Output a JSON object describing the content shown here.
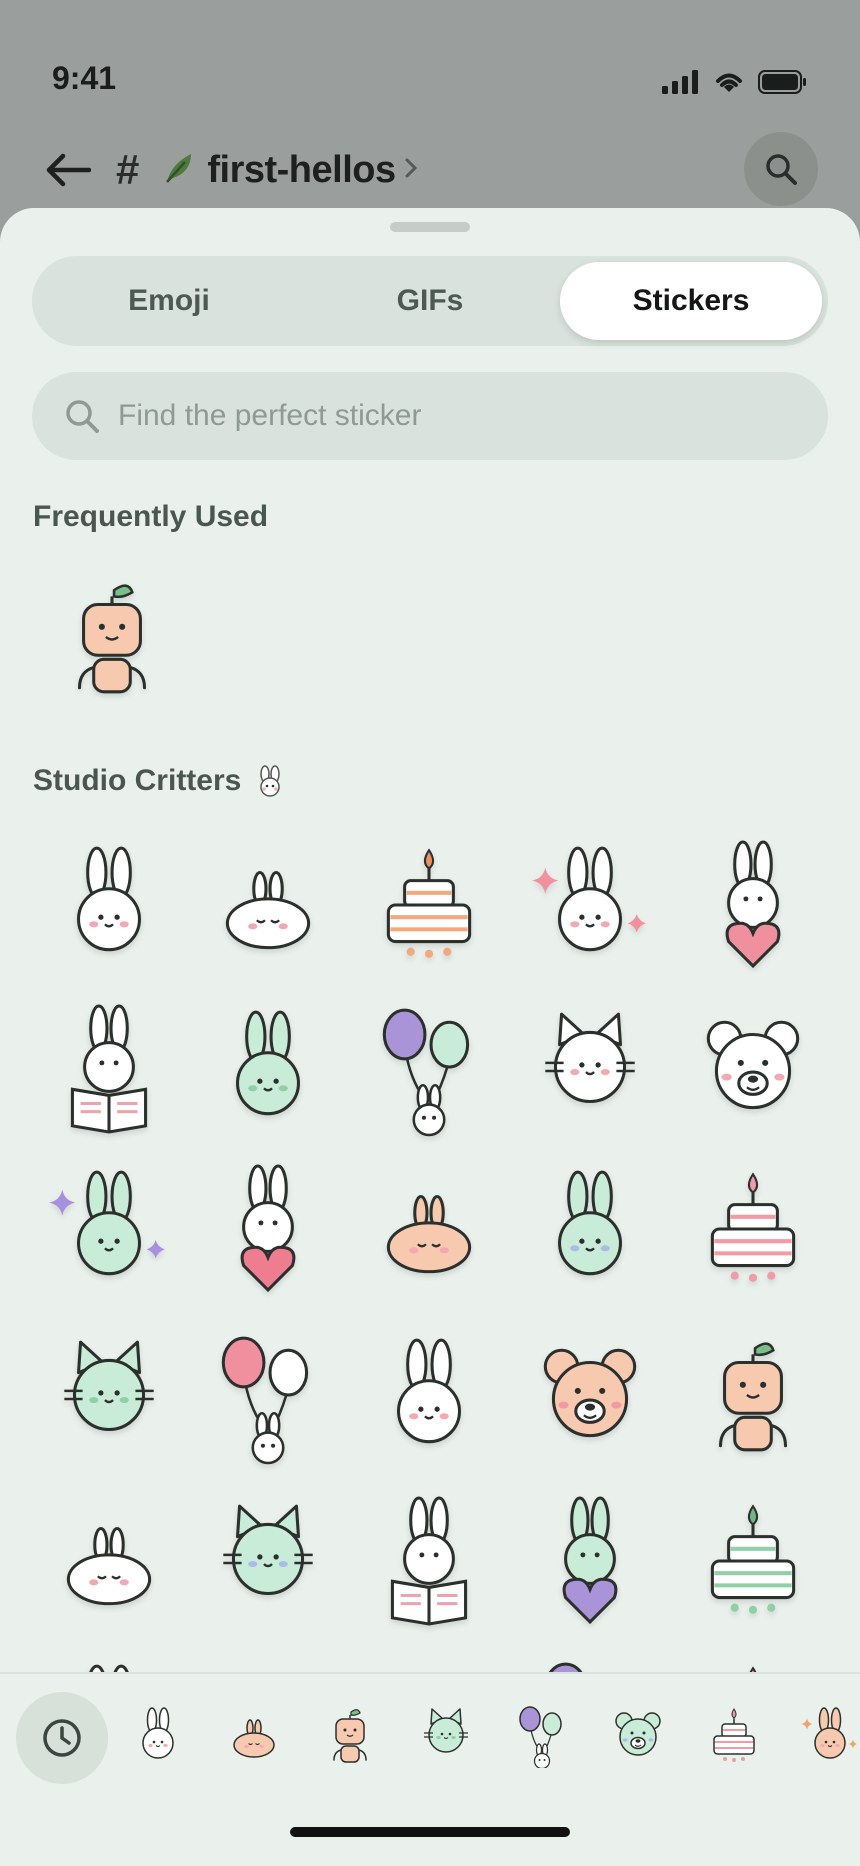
{
  "status_bar": {
    "time": "9:41"
  },
  "header": {
    "channel_name": "first-hellos",
    "hash": "#"
  },
  "tabs": [
    {
      "label": "Emoji",
      "active": false
    },
    {
      "label": "GIFs",
      "active": false
    },
    {
      "label": "Stickers",
      "active": true
    }
  ],
  "search": {
    "placeholder": "Find the perfect sticker"
  },
  "sections": {
    "frequently_used": {
      "title": "Frequently Used",
      "stickers": [
        "robot"
      ]
    },
    "studio_critters": {
      "title": "Studio Critters",
      "stickers": [
        "bunny-white",
        "bunny-sleepy",
        "cake-peach",
        "bunny-sparkle-pink",
        "bunny-heart-pink",
        "bunny-book-pink",
        "bunny-mint",
        "balloons-purple-bunny",
        "cat-white",
        "bear-white",
        "bunny-sparkle-purple",
        "bunny-heart-red",
        "bunny-sleepy-peach",
        "bunny-mint-blue",
        "cake-pink",
        "cat-mint",
        "balloons-pink-bunny",
        "bunny-white",
        "bear-peach",
        "robot",
        "bunny-sleepy-white",
        "cat-mint-blue",
        "bunny-book-pink",
        "bunny-heart-purple",
        "cake-mint"
      ]
    }
  },
  "tray": {
    "recent_icon": "clock-icon",
    "items": [
      "bunny-white",
      "bunny-sleepy-peach",
      "robot",
      "cat-mint",
      "balloons-purple-bunny",
      "bear-mint",
      "cake-pink",
      "bunny-sparkle-peach"
    ]
  },
  "colors": {
    "sheet": "#eaf0ec",
    "segment": "#d9e2dc",
    "accent_text": "#151716",
    "muted": "#8e9a93"
  }
}
